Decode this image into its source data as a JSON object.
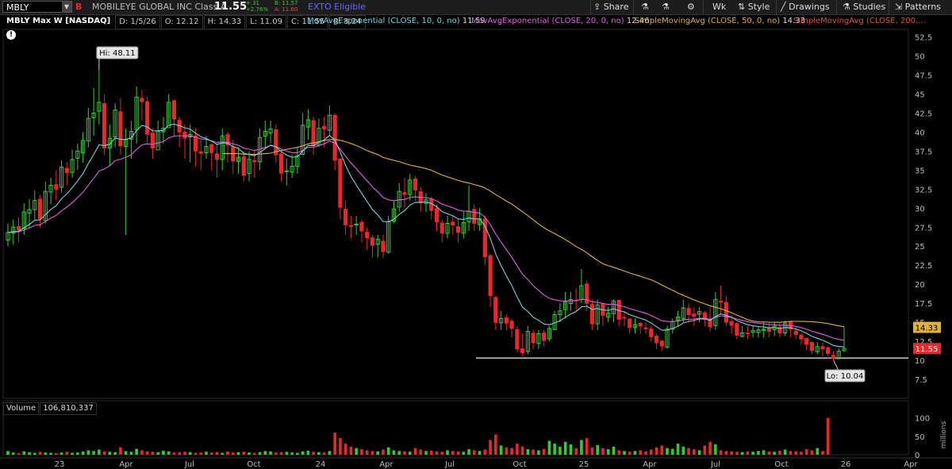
{
  "toolbar": {
    "symbol": "MBLY",
    "flag": "B",
    "company": "MOBILEYE GLOBAL INC Class A",
    "last": "11.55",
    "change": "+.31",
    "change_pct": "+2.76%",
    "bid": "B: 11.57",
    "ask": "A: 11.60",
    "exto": "EXTO Eligible",
    "share_label": "Share",
    "period_label": "Wk",
    "style_label": "Style",
    "drawings_label": "Drawings",
    "studies_label": "Studies",
    "patterns_label": "Patterns"
  },
  "infobar": {
    "title": "MBLY Max W [NASDAQ]",
    "date": "D: 1/5/26",
    "open": "O: 12.12",
    "high": "H: 14.33",
    "low": "L: 11.09",
    "close": "C: 11.55",
    "range": "R: 3.24"
  },
  "legends": [
    {
      "label": "MovAvgExponential (CLOSE, 10, 0, no)",
      "value": "11.59",
      "color": "#6fd6de"
    },
    {
      "label": "MovAvgExponential (CLOSE, 20, 0, no)",
      "value": "12.46",
      "color": "#e060e0"
    },
    {
      "label": "SimpleMovingAvg (CLOSE, 50, 0, no)",
      "value": "14.33",
      "color": "#e0b040"
    },
    {
      "label": "SimpleMovingAvg (CLOSE, 200,...",
      "value": "",
      "color": "#e05050"
    }
  ],
  "colors": {
    "up": "#33cc33",
    "down": "#e8282a",
    "ema10": "#6fd6de",
    "ema20": "#e060e0",
    "sma50": "#e0b040",
    "support": "#dddddd"
  },
  "volume": {
    "label": "Volume",
    "value": "106,810,337",
    "axis_unit": "millions",
    "ticks": [
      "100",
      "50",
      "0"
    ]
  },
  "annotations": {
    "high": "Hi: 48.11",
    "low": "Lo: 10.04"
  },
  "price_badges": {
    "sma50": "14.33",
    "last": "11.55"
  },
  "chart_data": {
    "type": "candlestick",
    "title": "MBLY Max W [NASDAQ]",
    "ylim": [
      5.0,
      53.5
    ],
    "y_ticks": [
      "52.5",
      "50",
      "47.5",
      "45",
      "42.5",
      "40",
      "37.5",
      "35",
      "32.5",
      "30",
      "27.5",
      "25",
      "22.5",
      "20",
      "17.5",
      "15",
      "12.5",
      "10",
      "7.5"
    ],
    "x_ticks": [
      "23",
      "Apr",
      "Jul",
      "Oct",
      "24",
      "Apr",
      "Jul",
      "Oct",
      "25",
      "Apr",
      "Jul",
      "Oct",
      "26",
      "Apr"
    ],
    "support_level": 10.3,
    "weeks": 157,
    "close": [
      26.8,
      27.5,
      27.1,
      29.5,
      29.8,
      31.0,
      28.6,
      32.2,
      33.0,
      32.5,
      35.4,
      34.7,
      36.4,
      37.5,
      38.9,
      41.8,
      42.5,
      43.9,
      37.9,
      39.2,
      42.9,
      38.2,
      39.0,
      40.1,
      44.6,
      44.0,
      39.7,
      37.9,
      40.1,
      40.5,
      43.9,
      41.7,
      40.0,
      39.2,
      39.7,
      37.5,
      37.2,
      38.1,
      37.3,
      36.4,
      39.5,
      38.3,
      36.2,
      36.7,
      34.3,
      36.4,
      36.1,
      39.3,
      40.1,
      40.4,
      37.0,
      34.6,
      34.9,
      35.5,
      36.9,
      40.9,
      41.6,
      38.2,
      40.5,
      40.4,
      42.2,
      36.3,
      30.1,
      27.8,
      27.7,
      27.9,
      27.0,
      26.1,
      25.1,
      25.9,
      24.3,
      28.2,
      29.9,
      32.2,
      31.8,
      33.7,
      32.4,
      30.7,
      31.1,
      29.7,
      28.2,
      26.7,
      28.0,
      27.8,
      26.8,
      28.1,
      29.6,
      28.0,
      28.6,
      23.6,
      18.5,
      15.0,
      15.5,
      14.9,
      14.2,
      11.5,
      11.0,
      13.8,
      12.3,
      13.5,
      12.6,
      14.2,
      16.0,
      16.5,
      17.7,
      18.0,
      17.9,
      19.8,
      17.5,
      14.8,
      17.3,
      15.9,
      16.2,
      17.8,
      15.4,
      15.6,
      14.3,
      14.7,
      14.5,
      14.2,
      13.1,
      12.3,
      11.9,
      14.1,
      15.1,
      15.7,
      16.9,
      16.0,
      15.8,
      16.4,
      15.4,
      14.4,
      18.0,
      17.7,
      15.0,
      14.6,
      13.3,
      13.6,
      13.5,
      13.9,
      14.0,
      14.1,
      13.8,
      14.5,
      13.6,
      14.9,
      14.1,
      13.4,
      12.8,
      12.1,
      11.3,
      11.8,
      11.5,
      10.9,
      10.3,
      11.2,
      11.55
    ],
    "high": [
      28.0,
      28.5,
      28.8,
      30.6,
      31.2,
      32.3,
      31.7,
      33.5,
      34.0,
      35.0,
      36.3,
      36.0,
      37.7,
      38.5,
      40.0,
      43.2,
      45.8,
      48.11,
      45.0,
      41.0,
      43.8,
      44.5,
      40.5,
      41.5,
      46.0,
      45.5,
      44.7,
      40.5,
      41.5,
      42.0,
      45.0,
      43.5,
      42.0,
      41.0,
      41.0,
      40.5,
      39.0,
      39.5,
      38.5,
      38.5,
      40.5,
      40.0,
      39.0,
      38.0,
      37.5,
      37.5,
      37.5,
      40.5,
      41.5,
      41.5,
      41.0,
      37.5,
      36.5,
      37.0,
      38.0,
      42.5,
      43.0,
      42.0,
      41.8,
      42.0,
      43.5,
      42.5,
      36.5,
      31.0,
      29.0,
      29.0,
      28.5,
      27.5,
      26.5,
      26.5,
      26.5,
      29.0,
      31.0,
      33.3,
      34.0,
      34.5,
      34.2,
      32.8,
      32.0,
      31.5,
      30.5,
      28.5,
      29.0,
      29.0,
      28.5,
      29.5,
      33.0,
      30.5,
      30.0,
      29.0,
      24.0,
      18.5,
      16.5,
      16.0,
      15.5,
      14.5,
      13.5,
      14.5,
      14.0,
      14.0,
      14.0,
      14.5,
      16.5,
      17.5,
      19.0,
      19.0,
      19.5,
      22.0,
      20.5,
      18.0,
      18.0,
      17.5,
      17.0,
      18.0,
      17.5,
      16.5,
      15.5,
      15.5,
      15.0,
      15.0,
      14.5,
      13.5,
      12.5,
      14.5,
      15.5,
      16.5,
      18.0,
      17.5,
      17.0,
      17.0,
      16.5,
      17.0,
      19.0,
      19.8,
      18.5,
      16.0,
      15.0,
      14.5,
      14.5,
      14.5,
      14.5,
      15.0,
      15.0,
      15.0,
      15.0,
      15.2,
      15.0,
      14.5,
      13.6,
      13.0,
      12.5,
      12.4,
      12.3,
      11.8,
      11.2,
      11.6,
      14.33
    ],
    "low": [
      25.0,
      25.2,
      25.5,
      26.5,
      27.5,
      28.5,
      27.5,
      28.0,
      30.5,
      31.0,
      32.0,
      33.0,
      34.0,
      35.0,
      36.0,
      38.0,
      39.5,
      41.0,
      37.0,
      35.5,
      38.0,
      37.0,
      26.5,
      36.5,
      38.5,
      41.5,
      38.5,
      36.5,
      38.0,
      38.5,
      41.0,
      39.5,
      38.0,
      36.5,
      36.0,
      35.5,
      35.0,
      36.5,
      35.0,
      34.0,
      35.0,
      36.0,
      34.5,
      34.5,
      33.5,
      33.5,
      34.0,
      35.0,
      38.0,
      38.5,
      36.0,
      33.5,
      33.0,
      34.0,
      34.5,
      37.0,
      39.0,
      37.0,
      38.0,
      38.0,
      39.5,
      35.0,
      28.5,
      26.5,
      26.0,
      26.5,
      25.5,
      24.5,
      23.5,
      23.5,
      23.5,
      24.0,
      28.0,
      29.5,
      30.0,
      31.0,
      31.0,
      29.5,
      29.5,
      28.5,
      27.0,
      25.5,
      26.0,
      26.5,
      25.5,
      26.0,
      27.0,
      27.0,
      27.0,
      22.5,
      17.0,
      14.0,
      14.0,
      14.0,
      13.0,
      11.0,
      10.5,
      10.8,
      11.5,
      11.5,
      11.8,
      12.5,
      14.0,
      15.0,
      15.5,
      16.5,
      16.5,
      17.5,
      16.5,
      14.0,
      14.0,
      14.5,
      15.0,
      15.0,
      14.5,
      14.5,
      13.5,
      13.5,
      13.5,
      13.5,
      12.5,
      11.5,
      11.2,
      11.5,
      13.5,
      14.5,
      15.0,
      15.0,
      14.5,
      15.0,
      14.5,
      13.8,
      14.0,
      16.0,
      14.5,
      13.5,
      12.8,
      13.0,
      12.8,
      13.0,
      13.0,
      13.0,
      13.0,
      13.2,
      13.0,
      13.2,
      13.0,
      12.8,
      12.0,
      11.3,
      10.8,
      10.8,
      10.5,
      10.2,
      10.04,
      10.4,
      11.09
    ],
    "volume_millions": [
      10,
      6,
      4,
      9,
      7,
      5,
      8,
      6,
      5,
      4,
      6,
      8,
      5,
      6,
      9,
      12,
      10,
      14,
      9,
      8,
      7,
      20,
      10,
      8,
      16,
      12,
      9,
      8,
      7,
      11,
      9,
      6,
      7,
      8,
      7,
      5,
      6,
      8,
      6,
      7,
      5,
      9,
      6,
      7,
      8,
      6,
      5,
      7,
      10,
      9,
      6,
      7,
      8,
      6,
      5,
      9,
      11,
      8,
      7,
      6,
      10,
      60,
      45,
      30,
      22,
      18,
      15,
      12,
      10,
      9,
      14,
      20,
      12,
      10,
      9,
      8,
      18,
      14,
      10,
      11,
      9,
      8,
      12,
      10,
      9,
      8,
      15,
      12,
      10,
      14,
      40,
      55,
      25,
      20,
      18,
      30,
      22,
      15,
      14,
      12,
      16,
      38,
      30,
      22,
      35,
      28,
      18,
      40,
      45,
      20,
      26,
      18,
      15,
      22,
      12,
      10,
      8,
      10,
      12,
      9,
      14,
      20,
      25,
      18,
      16,
      30,
      22,
      18,
      15,
      12,
      25,
      35,
      28,
      12,
      10,
      9,
      8,
      7,
      9,
      8,
      10,
      12,
      9,
      8,
      11,
      14,
      10,
      9,
      8,
      15,
      12,
      18,
      10,
      100
    ]
  }
}
